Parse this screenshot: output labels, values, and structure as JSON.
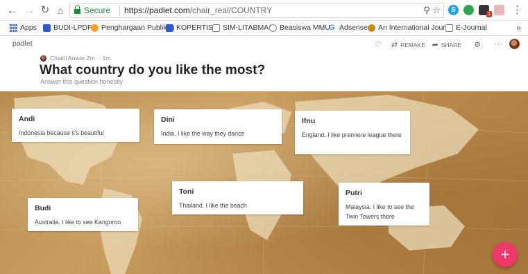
{
  "browser": {
    "secure_label": "Secure",
    "url_host": "https://padlet.com",
    "url_path": "/chair_real/COUNTRY",
    "bookmarks": [
      {
        "label": "Apps",
        "color": "#4a7adf"
      },
      {
        "label": "BUDI-LPDP",
        "color": "#2a5bd0"
      },
      {
        "label": "Penghargaan Publikas",
        "color": "#f4a321"
      },
      {
        "label": "KOPERTIS6",
        "color": "#2a5bd0"
      },
      {
        "label": "SIM-LITABMAS",
        "color": "#888888"
      },
      {
        "label": "Beasiswa MMU",
        "color": "#888888"
      },
      {
        "label": "Adsense",
        "color": "#4285f4"
      },
      {
        "label": "An International Journ",
        "color": "#c98a1a"
      },
      {
        "label": "E-Journal",
        "color": "#888888"
      }
    ],
    "bookmarks_more": "»",
    "extension_badge": "1"
  },
  "padlet": {
    "brand": "padlet",
    "toolbar": {
      "remake_label": "REMAKE",
      "share_label": "SHARE"
    },
    "author": "Chairil Anwar Zm",
    "time": "1m",
    "title": "What country do you like the most?",
    "subtitle": "Answer this question honestly",
    "fab_label": "+"
  },
  "posts": [
    {
      "name": "Andi",
      "text": "Indonesia because it's beautiful"
    },
    {
      "name": "Dini",
      "text": "India. I like the way they dance"
    },
    {
      "name": "Ifnu",
      "text": "England. I like premiere league there"
    },
    {
      "name": "Budi",
      "text": "Australia. I like to see Kangoroo"
    },
    {
      "name": "Toni",
      "text": "Thailand. I like the beach"
    },
    {
      "name": "Putri",
      "text": "Malaysia. I like to see the Twin Towers there"
    }
  ],
  "colors": {
    "accent": "#f0386b",
    "secure": "#1a8a3a",
    "map_bg": "#c99d5f"
  }
}
